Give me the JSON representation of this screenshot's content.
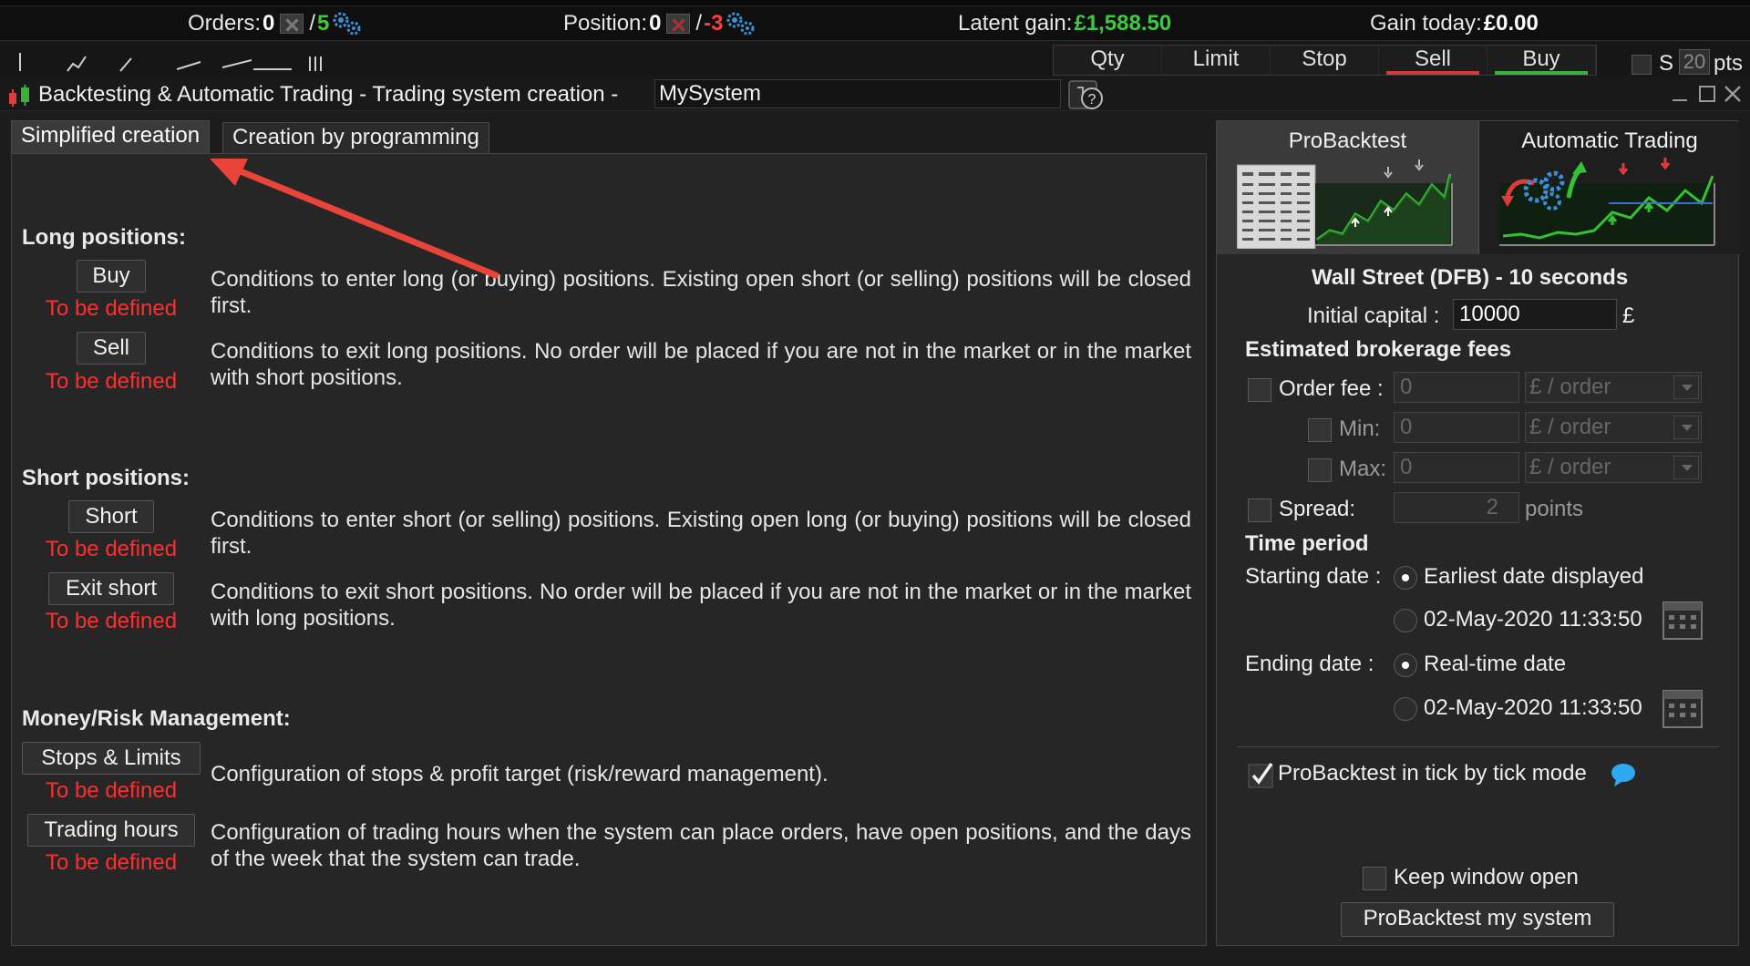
{
  "topbar": {
    "orders_label": "Orders:",
    "orders_value": "0",
    "orders_sep": "/",
    "orders_auto": "5",
    "position_label": "Position:",
    "position_value": "0",
    "position_sep": "/",
    "position_auto": "-3",
    "latent_label": "Latent gain:",
    "latent_value": "£1,588.50",
    "gain_label": "Gain today:",
    "gain_value": "£0.00"
  },
  "toolbar": {
    "order_tabs": [
      "Qty",
      "Limit",
      "Stop",
      "Sell",
      "Buy"
    ],
    "s_label": "S",
    "pts_value": "20",
    "pts_label": "pts"
  },
  "window": {
    "title": "Backtesting & Automatic Trading - Trading system creation -",
    "system_name": "MySystem"
  },
  "mode_tabs": {
    "simplified": "Simplified creation",
    "programming": "Creation by programming"
  },
  "sections": {
    "long": "Long positions:",
    "short": "Short positions:",
    "money": "Money/Risk Management:"
  },
  "rows": {
    "buy": {
      "button": "Buy",
      "status": "To be defined",
      "desc": "Conditions to enter long (or buying) positions. Existing open short (or selling) positions will be closed first."
    },
    "sell": {
      "button": "Sell",
      "status": "To be defined",
      "desc": "Conditions to exit long positions.  No order will be placed if you are not in the market or in the market with short positions."
    },
    "short": {
      "button": "Short",
      "status": "To be defined",
      "desc": "Conditions to enter short (or selling) positions. Existing open long (or buying) positions will be closed first."
    },
    "exit_short": {
      "button": "Exit short",
      "status": "To be defined",
      "desc": "Conditions to exit short positions.  No order will be placed if you are not in the market or in the market with long positions."
    },
    "stops": {
      "button": "Stops & Limits",
      "status": "To be defined",
      "desc": "Configuration of stops & profit target (risk/reward management)."
    },
    "hours": {
      "button": "Trading hours",
      "status": "To be defined",
      "desc": "Configuration of trading hours when the system can place orders, have open positions, and the days of the week that the system can trade."
    }
  },
  "right": {
    "tab_probacktest": "ProBacktest",
    "tab_auto": "Automatic Trading",
    "instrument": "Wall Street (DFB) - 10 seconds",
    "capital_label": "Initial capital :",
    "capital_value": "10000",
    "capital_currency": "£",
    "fees_heading": "Estimated brokerage fees",
    "order_fee_label": "Order fee :",
    "min_label": "Min:",
    "max_label": "Max:",
    "fee_value": "0",
    "fee_unit": "£ / order",
    "spread_label": "Spread:",
    "spread_value": "2",
    "spread_unit": "points",
    "time_heading": "Time period",
    "start_label": "Starting date :",
    "start_opt1": "Earliest date displayed",
    "start_opt2": "02-May-2020 11:33:50",
    "end_label": "Ending date :",
    "end_opt1": "Real-time date",
    "end_opt2": "02-May-2020 11:33:50",
    "tick_label": "ProBacktest in tick by tick mode",
    "keep_open_label": "Keep window open",
    "run_button": "ProBacktest my system"
  },
  "colors": {
    "status_red": "#ff2e2e",
    "gain_green": "#3ec93e",
    "arrow_red": "#e8443a"
  }
}
